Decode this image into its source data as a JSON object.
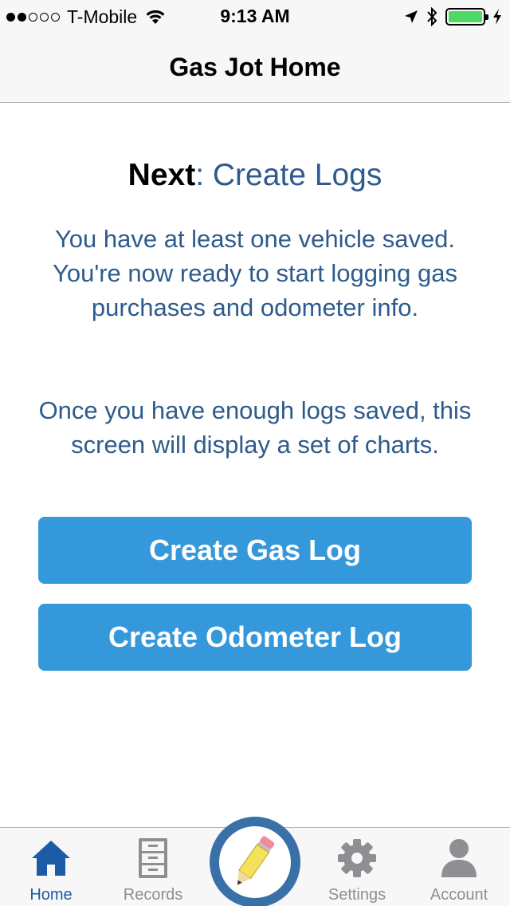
{
  "status_bar": {
    "carrier": "T-Mobile",
    "time": "9:13 AM",
    "signal_bars": 2,
    "signal_total": 5,
    "battery_level": 1.0
  },
  "nav": {
    "title": "Gas Jot Home"
  },
  "main": {
    "heading_next": "Next",
    "heading_rest": ": Create Logs",
    "message_1": "You have at least one vehicle saved.  You're now ready to start logging gas purchases and odometer info.",
    "message_2": "Once you have enough logs saved, this screen will display a set of charts.",
    "create_gas_log_label": "Create Gas Log",
    "create_odometer_log_label": "Create Odometer Log"
  },
  "tabs": [
    {
      "label": "Home",
      "icon": "home-icon",
      "active": true
    },
    {
      "label": "Records",
      "icon": "file-cabinet-icon",
      "active": false
    },
    {
      "label": "",
      "icon": "pencil-icon",
      "active": false
    },
    {
      "label": "Settings",
      "icon": "gear-icon",
      "active": false
    },
    {
      "label": "Account",
      "icon": "person-icon",
      "active": false
    }
  ],
  "colors": {
    "accent": "#3498db",
    "text_blue": "#2e5b8c",
    "tab_active": "#1d5aa8",
    "tab_inactive": "#8e8e93",
    "battery": "#4cd964",
    "center_ring": "#3a70a8"
  }
}
